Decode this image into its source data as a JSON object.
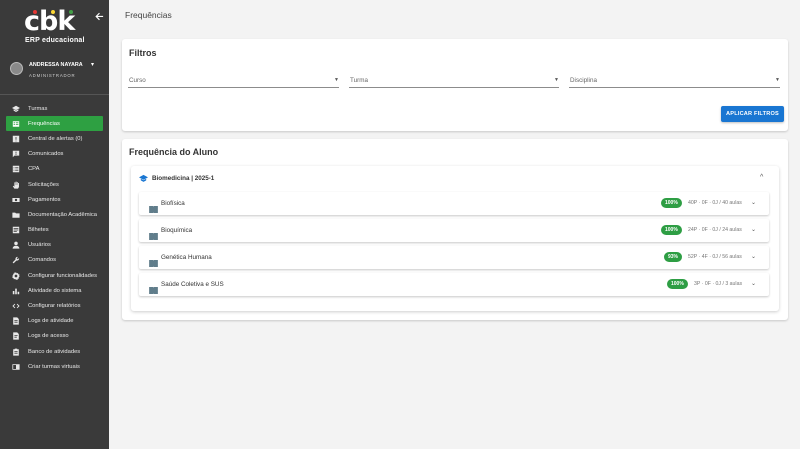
{
  "brand": {
    "logo_text": "cbk",
    "subtitle": "ERP educacional",
    "dot_colors": [
      "#e53935",
      "#fdd835",
      "#43a047"
    ]
  },
  "user": {
    "name": "ANDRESSA NAYARA",
    "role": "ADMINISTRADOR"
  },
  "sidebar": {
    "items": [
      {
        "label": "Turmas",
        "icon": "graduation-cap-icon"
      },
      {
        "label": "Frequências",
        "icon": "attendance-card-icon",
        "active": true
      },
      {
        "label": "Central de alertas (0)",
        "icon": "alert-icon"
      },
      {
        "label": "Comunicados",
        "icon": "announcement-icon"
      },
      {
        "label": "CPA",
        "icon": "checklist-icon"
      },
      {
        "label": "Solicitações",
        "icon": "hand-icon"
      },
      {
        "label": "Pagamentos",
        "icon": "money-icon"
      },
      {
        "label": "Documentação Acadêmica",
        "icon": "folder-icon"
      },
      {
        "label": "Bilhetes",
        "icon": "ticket-icon"
      },
      {
        "label": "Usuários",
        "icon": "person-icon"
      },
      {
        "label": "Comandos",
        "icon": "wrench-icon"
      },
      {
        "label": "Configurar funcionalidades",
        "icon": "gear-icon"
      },
      {
        "label": "Atividade do sistema",
        "icon": "bar-chart-icon"
      },
      {
        "label": "Configurar relatórios",
        "icon": "code-icon"
      },
      {
        "label": "Logs de atividade",
        "icon": "log-icon"
      },
      {
        "label": "Logs de acesso",
        "icon": "access-log-icon"
      },
      {
        "label": "Banco de atividades",
        "icon": "clipboard-icon"
      },
      {
        "label": "Criar turmas virtuais",
        "icon": "virtual-class-icon"
      }
    ]
  },
  "page": {
    "title": "Frequências"
  },
  "filters": {
    "title": "Filtros",
    "curso_label": "Curso",
    "turma_label": "Turma",
    "disciplina_label": "Disciplina",
    "apply_label": "APLICAR FILTROS"
  },
  "attendance": {
    "title": "Frequência do Aluno",
    "course": "Biomedicina | 2025-1",
    "subjects": [
      {
        "name": "Biofísica",
        "percent": "100%",
        "stats": "40P · 0F · 0J / 40 aulas"
      },
      {
        "name": "Bioquímica",
        "percent": "100%",
        "stats": "24P · 0F · 0J / 24 aulas"
      },
      {
        "name": "Genética Humana",
        "percent": "93%",
        "stats": "52P · 4F · 0J / 56 aulas"
      },
      {
        "name": "Saúde Coletiva e SUS",
        "percent": "100%",
        "stats": "3P · 0F · 0J / 3 aulas"
      }
    ]
  },
  "colors": {
    "sidebar_bg": "#3a3a3a",
    "active_green": "#2ea042",
    "primary_blue": "#1976d2",
    "badge_green": "#2e9e44"
  }
}
